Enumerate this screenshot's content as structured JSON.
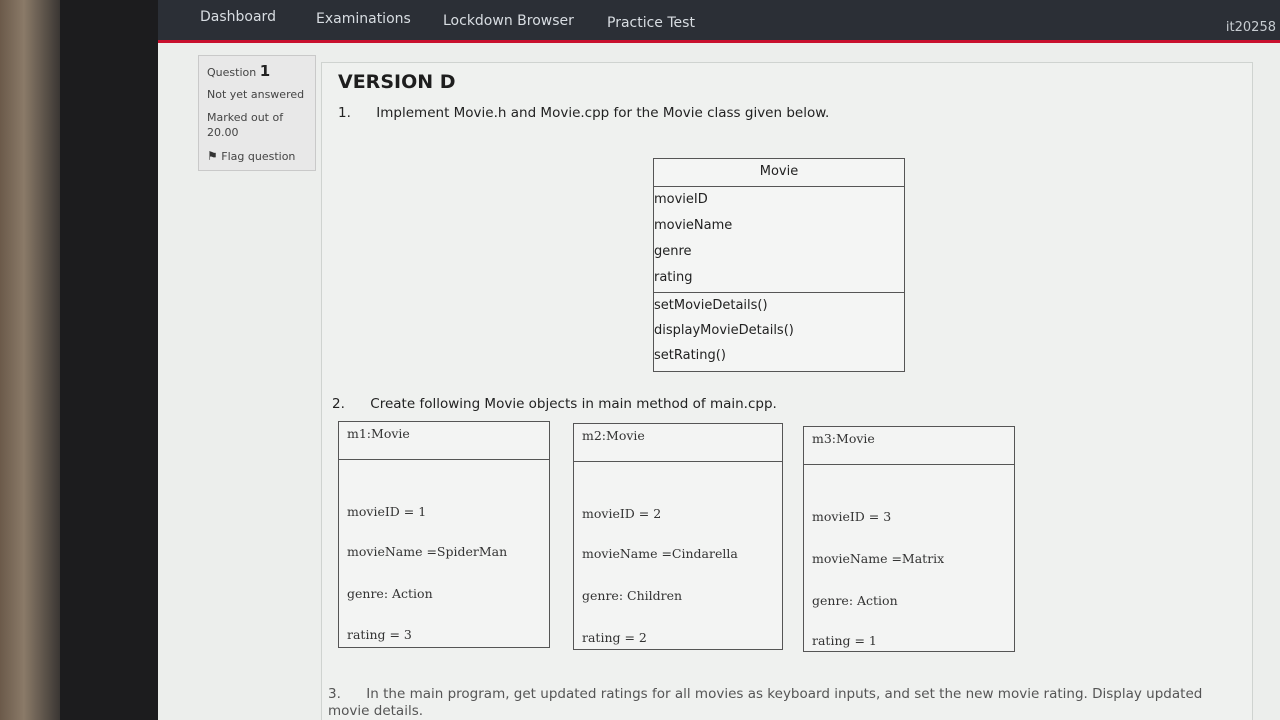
{
  "nav": {
    "items": [
      "Dashboard",
      "Examinations",
      "Lockdown Browser",
      "Practice Test"
    ],
    "user": "it20258"
  },
  "question_info": {
    "question_label": "Question",
    "question_number": "1",
    "state": "Not yet answered",
    "marked_line1": "Marked out of",
    "marked_line2": "20.00",
    "flag_label": "Flag question"
  },
  "content": {
    "version": "VERSION D",
    "q1": {
      "num": "1.",
      "text": "Implement Movie.h and Movie.cpp for the Movie class given below."
    },
    "class_diagram": {
      "name": "Movie",
      "attributes": [
        "movieID",
        "movieName",
        "genre",
        "rating"
      ],
      "methods": [
        "setMovieDetails()",
        "displayMovieDetails()",
        "setRating()"
      ]
    },
    "q2": {
      "num": "2.",
      "text": "Create following Movie objects in main method of main.cpp."
    },
    "objects": [
      {
        "title": "m1:Movie",
        "id": "movieID = 1",
        "name": "movieName =SpiderMan",
        "genre": "genre: Action",
        "rating": "rating = 3"
      },
      {
        "title": "m2:Movie",
        "id": "movieID = 2",
        "name": "movieName =Cindarella",
        "genre": "genre: Children",
        "rating": "rating = 2"
      },
      {
        "title": "m3:Movie",
        "id": "movieID = 3",
        "name": "movieName =Matrix",
        "genre": "genre: Action",
        "rating": "rating = 1"
      }
    ],
    "q3": {
      "num": "3.",
      "line1": "In the main program, get updated ratings for all movies as keyboard inputs, and set the new movie rating. Display updated",
      "line2": "movie details."
    }
  }
}
